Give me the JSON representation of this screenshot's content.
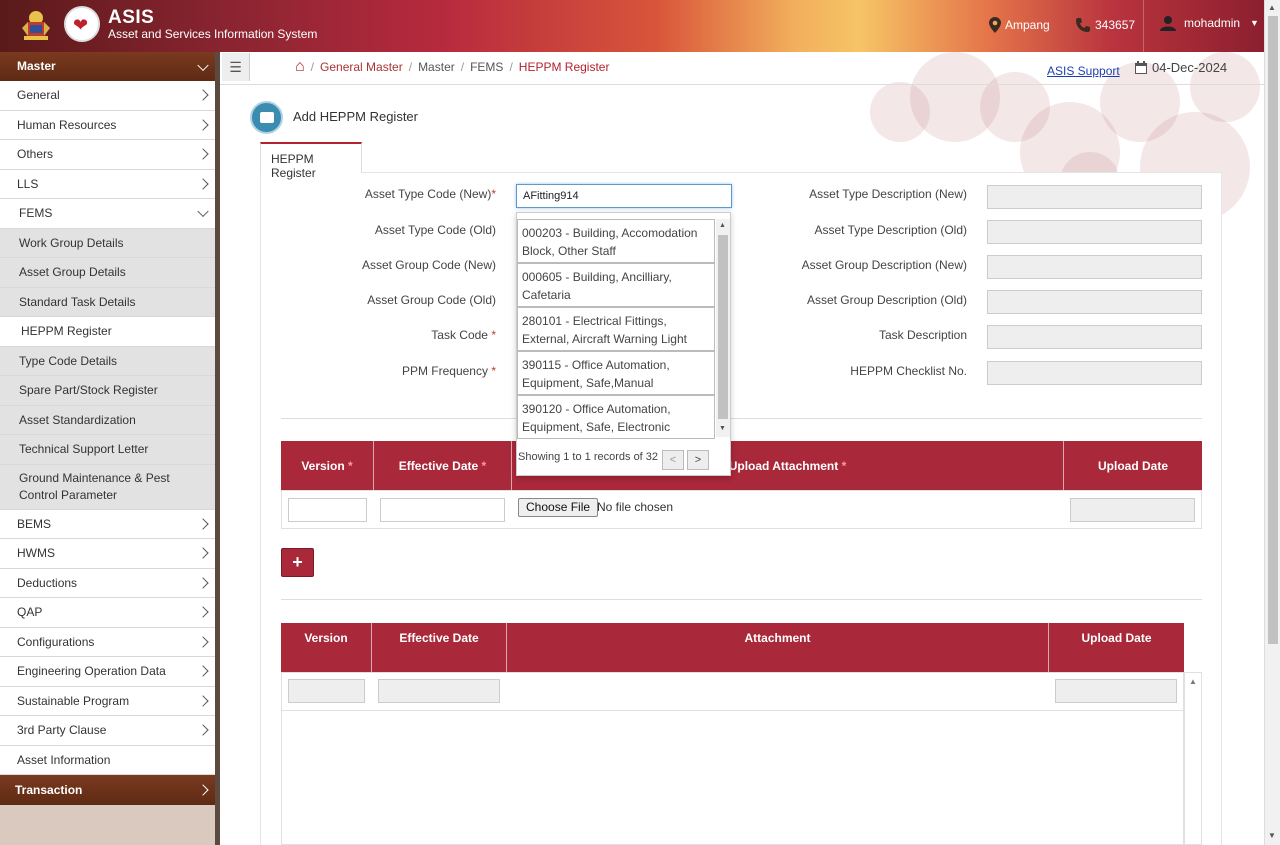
{
  "header": {
    "brand_title": "ASIS",
    "brand_subtitle": "Asset and Services Information System",
    "location": "Ampang",
    "phone": "343657",
    "user": "mohadmin"
  },
  "sidebar": {
    "section_master": "Master",
    "items": [
      {
        "label": "General"
      },
      {
        "label": "Human Resources"
      },
      {
        "label": "Others"
      },
      {
        "label": "LLS"
      },
      {
        "label": "FEMS"
      }
    ],
    "fems_sub": [
      {
        "label": "Work Group Details"
      },
      {
        "label": "Asset Group Details"
      },
      {
        "label": "Standard Task Details"
      },
      {
        "label": "HEPPM Register"
      },
      {
        "label": "Type Code Details"
      },
      {
        "label": "Spare Part/Stock Register"
      },
      {
        "label": "Asset Standardization"
      },
      {
        "label": "Technical Support Letter"
      },
      {
        "label": "Ground Maintenance & Pest Control Parameter"
      }
    ],
    "items_after": [
      {
        "label": "BEMS"
      },
      {
        "label": "HWMS"
      },
      {
        "label": "Deductions"
      },
      {
        "label": "QAP"
      },
      {
        "label": "Configurations"
      },
      {
        "label": "Engineering Operation Data"
      },
      {
        "label": "Sustainable Program"
      },
      {
        "label": "3rd Party Clause"
      },
      {
        "label": "Asset Information"
      }
    ],
    "section_transaction": "Transaction"
  },
  "breadcrumb": [
    "General Master",
    "Master",
    "FEMS",
    "HEPPM Register"
  ],
  "support_link": "ASIS Support",
  "date": "04-Dec-2024",
  "page_title": "Add HEPPM Register",
  "tab_label": "HEPPM Register",
  "form": {
    "asset_type_code_new_label": "Asset Type Code (New)",
    "asset_type_code_new_value": "AFitting914",
    "asset_type_code_old_label": "Asset Type Code (Old)",
    "asset_group_code_new_label": "Asset Group Code (New)",
    "asset_group_code_old_label": "Asset Group Code (Old)",
    "task_code_label": "Task Code",
    "ppm_frequency_label": "PPM Frequency",
    "asset_type_desc_new_label": "Asset Type Description (New)",
    "asset_type_desc_old_label": "Asset Type Description (Old)",
    "asset_group_desc_new_label": "Asset Group Description (New)",
    "asset_group_desc_old_label": "Asset Group Description (Old)",
    "task_desc_label": "Task Description",
    "checklist_label": "HEPPM Checklist No."
  },
  "dropdown": {
    "options": [
      "000203 - Building, Accomodation Block, Other Staff",
      "000605 - Building, Ancilliary, Cafetaria",
      "280101 - Electrical Fittings, External, Aircraft Warning Light",
      "390115 - Office Automation, Equipment, Safe,Manual",
      "390120 - Office Automation, Equipment, Safe, Electronic"
    ],
    "footer": "Showing 1 to 1 records of 32",
    "prev": "<",
    "next": ">"
  },
  "table1": {
    "headers": [
      "Version",
      "Effective Date",
      "Upload Attachment",
      "Upload Date"
    ],
    "file_button": "Choose File",
    "file_text": "No file chosen"
  },
  "add_button": "+",
  "table2": {
    "headers": [
      "Version",
      "Effective Date",
      "Attachment",
      "Upload Date"
    ]
  },
  "colors": {
    "accent": "#a9283a",
    "sidebar_section": "#6b3219"
  }
}
